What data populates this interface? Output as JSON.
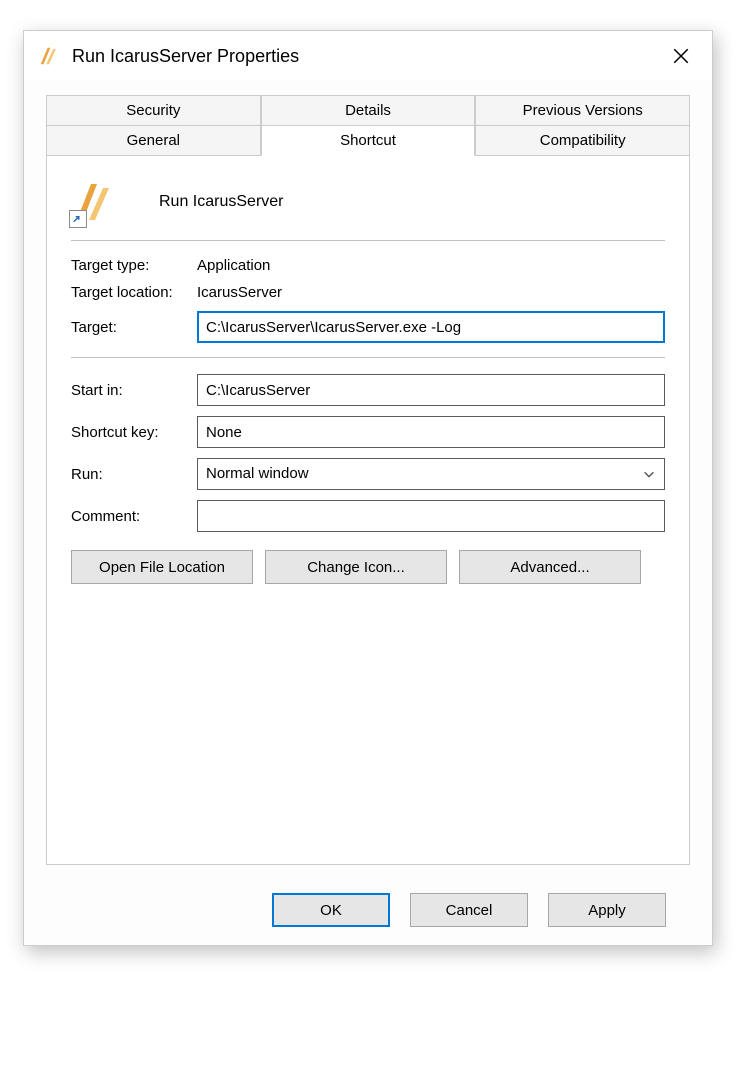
{
  "window": {
    "title": "Run IcarusServer Properties"
  },
  "tabs": {
    "row1": [
      "Security",
      "Details",
      "Previous Versions"
    ],
    "row2": [
      "General",
      "Shortcut",
      "Compatibility"
    ],
    "active": "Shortcut"
  },
  "header": {
    "name": "Run IcarusServer"
  },
  "fields": {
    "target_type_label": "Target type:",
    "target_type_value": "Application",
    "target_location_label": "Target location:",
    "target_location_value": "IcarusServer",
    "target_label": "Target:",
    "target_value": "C:\\IcarusServer\\IcarusServer.exe -Log",
    "start_in_label": "Start in:",
    "start_in_value": "C:\\IcarusServer",
    "shortcut_key_label": "Shortcut key:",
    "shortcut_key_value": "None",
    "run_label": "Run:",
    "run_value": "Normal window",
    "comment_label": "Comment:",
    "comment_value": ""
  },
  "buttons": {
    "open_file_location": "Open File Location",
    "change_icon": "Change Icon...",
    "advanced": "Advanced...",
    "ok": "OK",
    "cancel": "Cancel",
    "apply": "Apply"
  }
}
